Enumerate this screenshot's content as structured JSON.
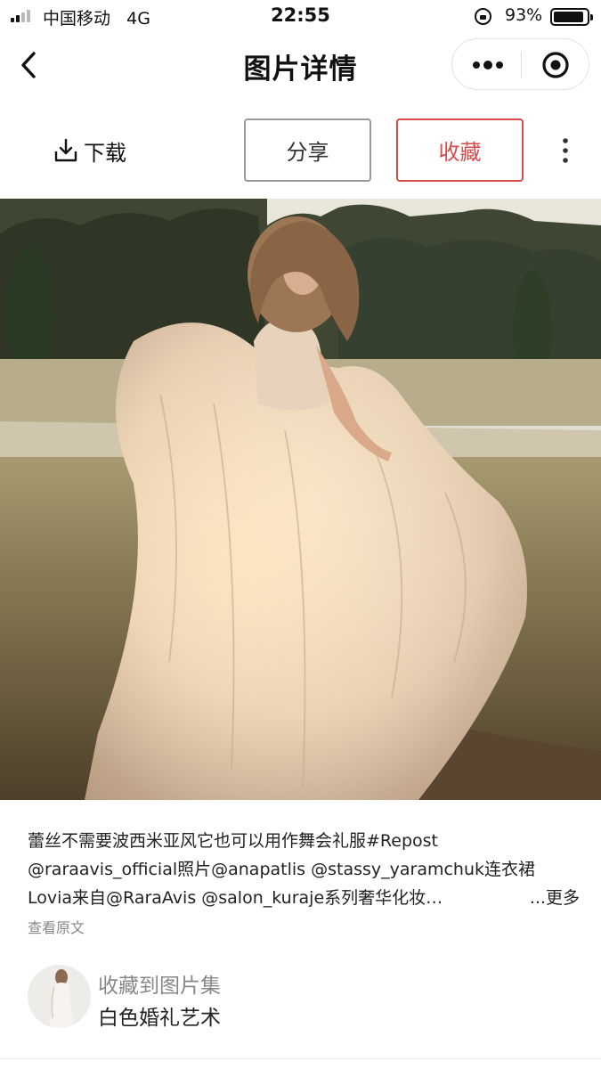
{
  "status_bar": {
    "carrier": "中国移动",
    "network": "4G",
    "time": "22:55",
    "battery": "93%",
    "battery_level": 0.93
  },
  "nav": {
    "title": "图片详情",
    "icons": {
      "back": "back-chevron-icon",
      "more": "more-dots-icon",
      "close": "target-circle-icon"
    }
  },
  "actions": {
    "download": "下载",
    "share": "分享",
    "favorite": "收藏",
    "favorite_color": "#d94a4a",
    "more_icon": "vertical-dots-icon"
  },
  "description": {
    "line1": "蕾丝不需要波西米亚风它也可以用作舞会礼服#Repost",
    "line2": "@raraavis_official照片@anapatlis @stassy_yaramchuk连衣裙",
    "line3": "Lovia来自@RaraAvis @salon_kuraje系列奢华化妆…",
    "more": "...更多",
    "view_original": "查看原文"
  },
  "collection": {
    "label": "收藏到图片集",
    "name": "白色婚礼艺术"
  }
}
